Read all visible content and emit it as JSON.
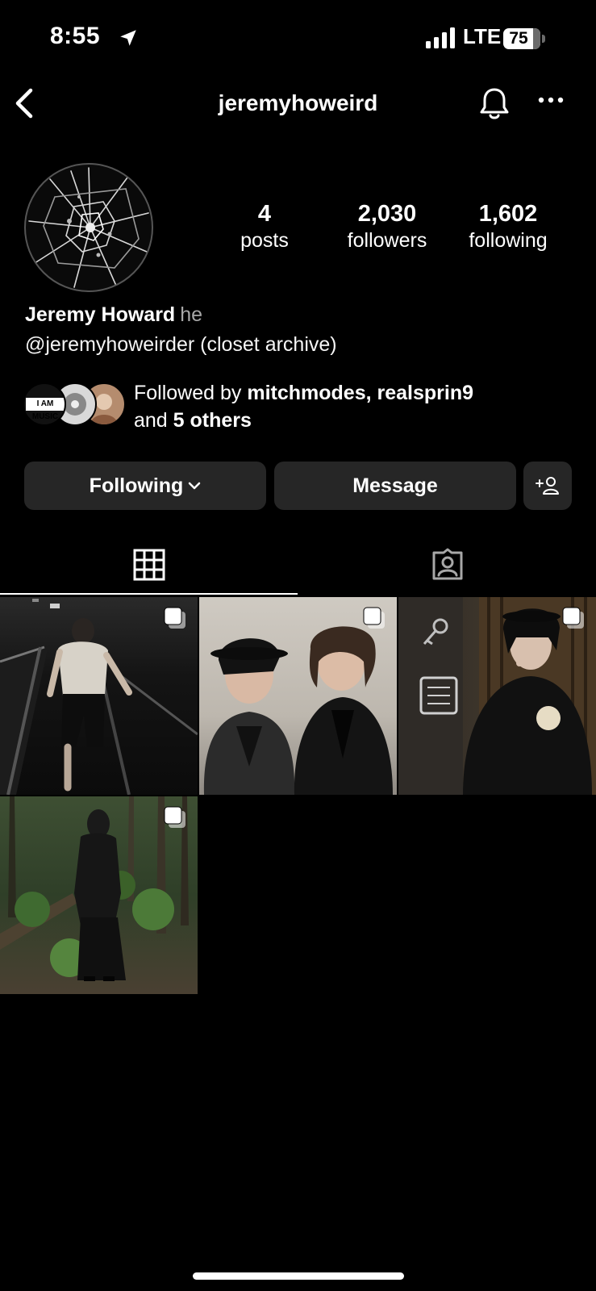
{
  "status_bar": {
    "time": "8:55",
    "network": "LTE",
    "battery": "75"
  },
  "header": {
    "username": "jeremyhoweird"
  },
  "profile": {
    "posts_count": "4",
    "posts_label": "posts",
    "followers_count": "2,030",
    "followers_label": "followers",
    "following_count": "1,602",
    "following_label": "following",
    "full_name": "Jeremy Howard",
    "pronouns": "he",
    "bio": "@jeremyhoweirder (closet archive)",
    "mutual_avatar_text": "I AM MUSIC",
    "followed_by_prefix": "Followed by ",
    "followed_by_names": "mitchmodes, realsprin9",
    "followed_by_and": "and ",
    "followed_by_others": "5 others"
  },
  "actions": {
    "following_label": "Following",
    "message_label": "Message"
  },
  "tabs": [
    {
      "icon": "grid-icon",
      "active": true
    },
    {
      "icon": "tagged-icon",
      "active": false
    }
  ],
  "posts": [
    {
      "type": "carousel"
    },
    {
      "type": "carousel"
    },
    {
      "type": "carousel"
    },
    {
      "type": "carousel"
    }
  ],
  "colors": {
    "background": "#000000",
    "button_bg": "#262626",
    "secondary_text": "#a8a8a8"
  }
}
